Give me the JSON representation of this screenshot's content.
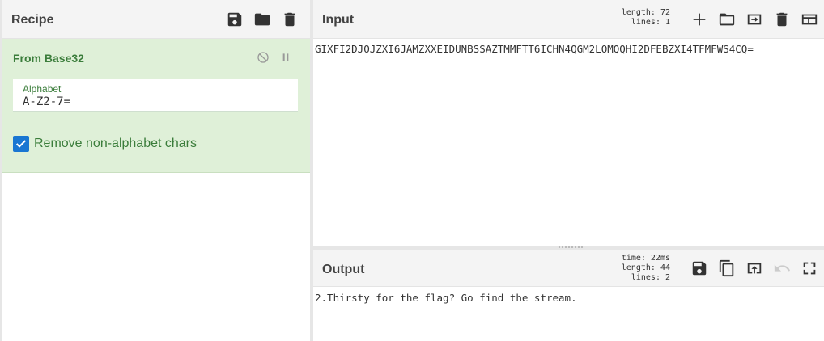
{
  "recipe": {
    "title": "Recipe",
    "operation": {
      "name": "From Base32",
      "alphabet_label": "Alphabet",
      "alphabet_value": "A-Z2-7=",
      "checkbox_label": "Remove non-alphabet chars",
      "checkbox_checked": true
    }
  },
  "input": {
    "title": "Input",
    "length_label": "length:",
    "length_value": "72",
    "lines_label": "lines:",
    "lines_value": "1",
    "text": "GIXFI2DJOJZXI6JAMZXXEIDUNBSSAZTMMFTT6ICHN4QGM2LOMQQHI2DFEBZXI4TFMFWS4CQ="
  },
  "output": {
    "title": "Output",
    "time_label": "time:",
    "time_value": "22ms",
    "length_label": "length:",
    "length_value": "44",
    "lines_label": "lines:",
    "lines_value": "2",
    "text": "2.Thirsty for the flag? Go find the stream."
  },
  "colors": {
    "operation_bg": "#dff0d8",
    "operation_text": "#3b7d3b",
    "checkbox": "#1976d2",
    "header_bg": "#f4f4f4"
  }
}
